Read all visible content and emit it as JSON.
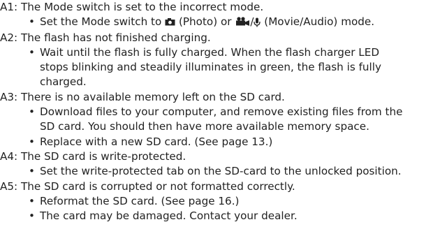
{
  "answers": [
    {
      "label": "A1:",
      "text": "The Mode switch is set to the incorrect mode.",
      "bullets": [
        {
          "parts": [
            "Set the Mode switch to ",
            " (Photo) or ",
            "/",
            " (Movie/Audio) mode."
          ],
          "icons": [
            "camera-icon",
            "movie-icon",
            "microphone-icon"
          ]
        }
      ]
    },
    {
      "label": "A2:",
      "text": "The flash has not finished charging.",
      "bullets": [
        {
          "lines": [
            "Wait until the flash is fully charged. When the flash charger LED",
            "stops blinking and steadily illuminates in green, the flash is fully",
            "charged."
          ]
        }
      ]
    },
    {
      "label": "A3:",
      "text": "There is no available memory left on the SD card.",
      "bullets": [
        {
          "lines": [
            "Download files to your computer, and remove existing files from the",
            "SD card. You should then have more available memory space."
          ]
        },
        {
          "lines": [
            "Replace with a new SD card. (See page 13.)"
          ]
        }
      ]
    },
    {
      "label": "A4:",
      "text": "The SD card is write-protected.",
      "bullets": [
        {
          "lines": [
            "Set the write-protected tab on the SD-card to the unlocked position."
          ]
        }
      ]
    },
    {
      "label": "A5:",
      "text": "The SD card is corrupted or not formatted correctly.",
      "bullets": [
        {
          "lines": [
            "Reformat the SD card. (See page 16.)"
          ]
        },
        {
          "lines": [
            "The card may be damaged. Contact your dealer."
          ]
        }
      ]
    }
  ],
  "bullet_glyph": "•"
}
